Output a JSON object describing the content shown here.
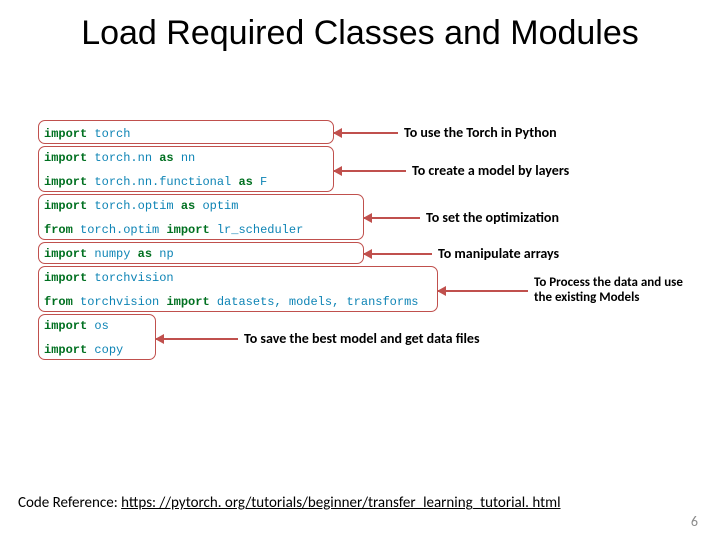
{
  "title": "Load Required Classes and Modules",
  "code": {
    "l0": {
      "a": "import",
      "b": " torch"
    },
    "l1": {
      "a": "import",
      "b": " torch.nn ",
      "c": "as",
      "d": " nn"
    },
    "l2": {
      "a": "import",
      "b": " torch.nn.functional ",
      "c": "as",
      "d": " F"
    },
    "l3": {
      "a": "import",
      "b": " torch.optim ",
      "c": "as",
      "d": " optim"
    },
    "l4": {
      "a": "from",
      "b": " torch.optim ",
      "c": "import",
      "d": " lr_scheduler"
    },
    "l5": {
      "a": "import",
      "b": " numpy ",
      "c": "as",
      "d": " np"
    },
    "l6": {
      "a": "import",
      "b": " torchvision"
    },
    "l7": {
      "a": "from",
      "b": " torchvision ",
      "c": "import",
      "d": " datasets, models, transforms"
    },
    "l8": {
      "a": "import",
      "b": " os"
    },
    "l9": {
      "a": "import",
      "b": " copy"
    }
  },
  "annotations": {
    "a1": "To use the Torch in Python",
    "a2": "To create a model by layers",
    "a3": "To set the optimization",
    "a4": "To manipulate arrays",
    "a5": "To Process the data and use the existing Models",
    "a6": "To save the best model and get data files"
  },
  "reference": {
    "label": "Code Reference: ",
    "url_text": "https: //pytorch. org/tutorials/beginner/transfer_learning_tutorial. html"
  },
  "page_number": "6"
}
